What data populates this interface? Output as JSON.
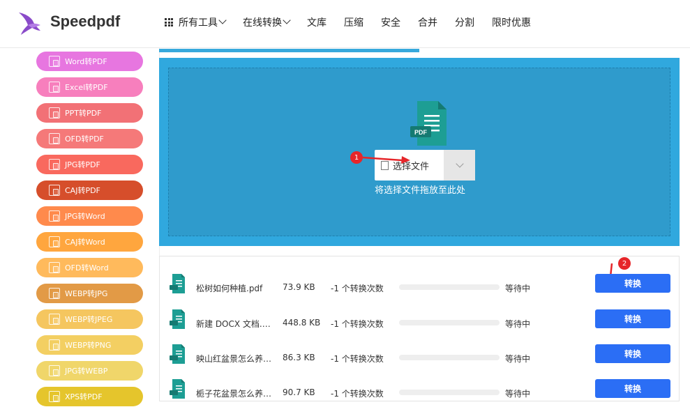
{
  "header": {
    "brand": "Speedpdf",
    "nav": [
      {
        "label": "所有工具",
        "dropdown": true,
        "grid_icon": true
      },
      {
        "label": "在线转换",
        "dropdown": true
      },
      {
        "label": "文库"
      },
      {
        "label": "压缩"
      },
      {
        "label": "安全"
      },
      {
        "label": "合并"
      },
      {
        "label": "分割"
      },
      {
        "label": "限时优惠"
      }
    ]
  },
  "sidebar": {
    "items": [
      {
        "label": "Word转PDF",
        "color": "#e776e0"
      },
      {
        "label": "Excel转PDF",
        "color": "#f77fbd"
      },
      {
        "label": "PPT转PDF",
        "color": "#f27176"
      },
      {
        "label": "OFD转PDF",
        "color": "#f57979"
      },
      {
        "label": "JPG转PDF",
        "color": "#f9695e"
      },
      {
        "label": "CAJ转PDF",
        "color": "#d64e2b"
      },
      {
        "label": "JPG转Word",
        "color": "#ff8a4c"
      },
      {
        "label": "CAJ转Word",
        "color": "#ffa63e"
      },
      {
        "label": "OFD转Word",
        "color": "#ffba5c"
      },
      {
        "label": "WEBP转JPG",
        "color": "#e29a46"
      },
      {
        "label": "WEBP转JPEG",
        "color": "#f5c65f"
      },
      {
        "label": "WEBP转PNG",
        "color": "#f3cf62"
      },
      {
        "label": "JPG转WEBP",
        "color": "#f0d66a"
      },
      {
        "label": "XPS转PDF",
        "color": "#e5c52c"
      }
    ]
  },
  "upload": {
    "file_icon_label": "PDF",
    "select_label": "选择文件",
    "drop_hint": "将选择文件拖放至此处",
    "marker1": "1"
  },
  "files": {
    "marker2": "2",
    "rows": [
      {
        "name": "松树如何种植.pdf",
        "size": "73.9 KB",
        "count": "-1 个转换次数",
        "status": "等待中",
        "button": "转换"
      },
      {
        "name": "新建 DOCX 文档.docx",
        "size": "448.8 KB",
        "count": "-1 个转换次数",
        "status": "等待中",
        "button": "转换"
      },
      {
        "name": "映山红盆景怎么养.docx",
        "size": "86.3 KB",
        "count": "-1 个转换次数",
        "status": "等待中",
        "button": "转换"
      },
      {
        "name": "栀子花盆景怎么养.docx",
        "size": "90.7 KB",
        "count": "-1 个转换次数",
        "status": "等待中",
        "button": "转换"
      }
    ]
  },
  "colors": {
    "accent": "#2b6ef5",
    "upload_bg": "#30a8de",
    "teal_icon": "#1d9e94",
    "marker": "#e6262a"
  }
}
